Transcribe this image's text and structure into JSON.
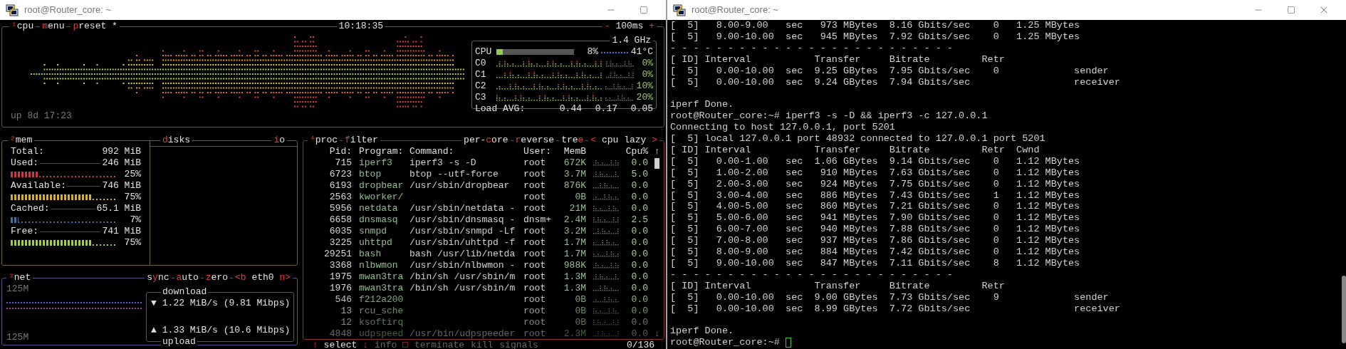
{
  "left_window": {
    "title": "root@Router_core: ~",
    "cpu_box": {
      "tabs": [
        [
          {
            "text": "¹",
            "hot": true
          },
          {
            "text": "cpu",
            "hot": false
          }
        ],
        [
          {
            "text": "m",
            "hot": true
          },
          {
            "text": "enu",
            "hot": false
          }
        ],
        [
          {
            "text": "p",
            "hot": true
          },
          {
            "text": "reset *",
            "hot": false
          }
        ]
      ],
      "clock": "10:18:35",
      "interval": {
        "minus": "-",
        "value": "100ms",
        "plus": "+"
      },
      "frequency": "1.4 GHz",
      "uptime": "up 8d 17:23",
      "cpu_total": {
        "label": "CPU",
        "level": 0.08,
        "percent": "8%",
        "temperature": "41°C"
      },
      "cores": [
        {
          "label": "C0",
          "percent": "0%"
        },
        {
          "label": "C1",
          "percent": "0%"
        },
        {
          "label": "C2",
          "percent": "10%"
        },
        {
          "label": "C3",
          "percent": "20%"
        }
      ],
      "load": {
        "label": "Load AVG:",
        "values": [
          "0.44",
          "0.17",
          "0.05"
        ]
      }
    },
    "mem_box": {
      "title": [
        {
          "text": "²",
          "hot": true
        },
        {
          "text": "mem",
          "hot": false
        }
      ],
      "rows": [
        {
          "kind": "total",
          "label": "Total:",
          "value": "992 MiB"
        },
        {
          "kind": "meter",
          "label": "Used:",
          "value": "246 MiB",
          "percent": "25%",
          "level": 0.25,
          "color": "#c83c3c"
        },
        {
          "kind": "meter",
          "label": "Available:",
          "value": "746 MiB",
          "percent": "75%",
          "level": 0.75,
          "color": "#d8b020"
        },
        {
          "kind": "meter",
          "label": "Cached:",
          "value": "65.1 MiB",
          "percent": "7%",
          "level": 0.07,
          "color": "#3c6ea8"
        },
        {
          "kind": "meter",
          "label": "Free:",
          "value": "741 MiB",
          "percent": "75%",
          "level": 0.75,
          "color": "#a0d040"
        }
      ]
    },
    "disks_box": {
      "title": [
        {
          "text": "d",
          "hot": true
        },
        {
          "text": "isks",
          "hot": false
        }
      ],
      "io": [
        {
          "text": "i",
          "hot": true
        },
        {
          "text": "o",
          "hot": false
        }
      ]
    },
    "net_box": {
      "title": [
        {
          "text": "³",
          "hot": true
        },
        {
          "text": "net",
          "hot": false
        }
      ],
      "controls": [
        [
          {
            "text": "s",
            "hot": false
          },
          {
            "text": "y",
            "hot": true
          },
          {
            "text": "nc",
            "hot": false
          }
        ],
        [
          {
            "text": "a",
            "hot": true
          },
          {
            "text": "uto",
            "hot": false
          }
        ],
        [
          {
            "text": "z",
            "hot": true
          },
          {
            "text": "ero",
            "hot": false
          }
        ],
        [
          {
            "text": "<b",
            "hot": true
          },
          {
            "text": " eth0 ",
            "hot": false
          },
          {
            "text": "n>",
            "hot": true
          }
        ]
      ],
      "scale_top": "125M",
      "scale_bottom": "125M",
      "download": {
        "label": "download",
        "arrow": "▼",
        "rate": "1.22 MiB/s (9.81 Mibps)"
      },
      "upload": {
        "label": "upload",
        "arrow": "▲",
        "rate": "1.33 MiB/s (10.6 Mibps)"
      }
    },
    "proc_box": {
      "title": [
        {
          "text": "⁴",
          "hot": true
        },
        {
          "text": "proc",
          "hot": false
        }
      ],
      "controls": [
        [
          {
            "text": "f",
            "hot": true
          },
          {
            "text": "ilter",
            "hot": false
          }
        ],
        [
          {
            "text": "per-",
            "hot": false
          },
          {
            "text": "c",
            "hot": true
          },
          {
            "text": "ore",
            "hot": false
          }
        ],
        [
          {
            "text": "r",
            "hot": true
          },
          {
            "text": "everse",
            "hot": false
          }
        ],
        [
          {
            "text": "tre",
            "hot": false
          },
          {
            "text": "e",
            "hot": true
          }
        ],
        [
          {
            "text": "<",
            "hot": true
          },
          {
            "text": " cpu lazy ",
            "hot": false
          },
          {
            "text": ">",
            "hot": true
          }
        ]
      ],
      "columns": [
        "Pid:",
        "Program:",
        "Command:",
        "User:",
        "MemB",
        "Cpu%"
      ],
      "rows": [
        {
          "pid": "715",
          "program": "iperf3",
          "command": "iperf3 -s -D",
          "user": "root",
          "mem": "672K",
          "cpu": "0.0"
        },
        {
          "pid": "6723",
          "program": "btop",
          "command": "btop --utf-force",
          "user": "root",
          "mem": "3.7M",
          "cpu": "5.0"
        },
        {
          "pid": "6193",
          "program": "dropbear",
          "command": "/usr/sbin/dropbear",
          "user": "root",
          "mem": "876K",
          "cpu": "0.0"
        },
        {
          "pid": "2563",
          "program": "kworker/",
          "command": "",
          "user": "root",
          "mem": "0B",
          "cpu": "0.0"
        },
        {
          "pid": "5956",
          "program": "netdata",
          "command": "/usr/sbin/netdata -",
          "user": "root",
          "mem": "21M",
          "cpu": "0.0"
        },
        {
          "pid": "6658",
          "program": "dnsmasq",
          "command": "/usr/sbin/dnsmasq -",
          "user": "dnsm+",
          "mem": "2.4M",
          "cpu": "2.5"
        },
        {
          "pid": "6035",
          "program": "snmpd",
          "command": "/usr/sbin/snmpd -Lf",
          "user": "root",
          "mem": "3.2M",
          "cpu": "0.0"
        },
        {
          "pid": "3225",
          "program": "uhttpd",
          "command": "/usr/sbin/uhttpd -f",
          "user": "root",
          "mem": "1.7M",
          "cpu": "0.0"
        },
        {
          "pid": "29251",
          "program": "bash",
          "command": "bash /usr/lib/netda",
          "user": "root",
          "mem": "1.7M",
          "cpu": "0.0"
        },
        {
          "pid": "3368",
          "program": "nlbwmon",
          "command": "/usr/sbin/nlbwmon -",
          "user": "root",
          "mem": "988K",
          "cpu": "0.0"
        },
        {
          "pid": "1975",
          "program": "mwan3tra",
          "command": "/bin/sh /usr/sbin/m",
          "user": "root",
          "mem": "1.3M",
          "cpu": "0.0"
        },
        {
          "pid": "1976",
          "program": "mwan3tra",
          "command": "/bin/sh /usr/sbin/m",
          "user": "root",
          "mem": "1.3M",
          "cpu": "0.0"
        },
        {
          "pid": "546",
          "program": "f212a200",
          "command": "",
          "user": "root",
          "mem": "0B",
          "cpu": "0.0"
        },
        {
          "pid": "13",
          "program": "rcu_sche",
          "command": "",
          "user": "root",
          "mem": "0B",
          "cpu": "0.0"
        },
        {
          "pid": "12",
          "program": "ksoftirq",
          "command": "",
          "user": "root",
          "mem": "0B",
          "cpu": "0.0"
        },
        {
          "pid": "4848",
          "program": "udpspeed",
          "command": "/usr/bin/udpspeeder",
          "user": "root",
          "mem": "2.3M",
          "cpu": "0.0"
        }
      ],
      "scroll_up": "↑",
      "scroll_down": "↓",
      "footer": [
        [
          {
            "text": "↑",
            "hot": true
          },
          {
            "text": " select ",
            "hot": false
          },
          {
            "text": "↓",
            "hot": true
          }
        ],
        [
          {
            "text": "info ",
            "hot": false
          },
          {
            "text": "□",
            "hot": true
          }
        ],
        [
          {
            "text": "terminate",
            "hot": false
          }
        ],
        [
          {
            "text": "kill",
            "hot": false
          }
        ],
        [
          {
            "text": "signals",
            "hot": false
          }
        ]
      ],
      "count": "0/136"
    }
  },
  "right_window": {
    "title": "root@Router_core: ~",
    "blocks": [
      [
        "[  5]   8.00-9.00   sec   973 MBytes  8.16 Gbits/sec    0   1.25 MBytes",
        "[  5]   9.00-10.00  sec   945 MBytes  7.92 Gbits/sec    0   1.25 MBytes",
        "- - - - - - - - - - - - - - - - - - - - - - - - -",
        "[ ID] Interval           Transfer     Bitrate         Retr",
        "[  5]   0.00-10.00  sec  9.25 GBytes  7.95 Gbits/sec    0             sender",
        "[  5]   0.00-10.00  sec  9.24 GBytes  7.94 Gbits/sec                  receiver"
      ],
      [
        "iperf Done.",
        "root@Router_core:~# iperf3 -s -D && iperf3 -c 127.0.0.1",
        "Connecting to host 127.0.0.1, port 5201",
        "[  5] local 127.0.0.1 port 48932 connected to 127.0.0.1 port 5201",
        "[ ID] Interval           Transfer     Bitrate         Retr  Cwnd",
        "[  5]   0.00-1.00   sec  1.06 GBytes  9.14 Gbits/sec    0   1.12 MBytes",
        "[  5]   1.00-2.00   sec   910 MBytes  7.63 Gbits/sec    0   1.12 MBytes",
        "[  5]   2.00-3.00   sec   924 MBytes  7.75 Gbits/sec    0   1.12 MBytes",
        "[  5]   3.00-4.00   sec   886 MBytes  7.43 Gbits/sec    1   1.12 MBytes",
        "[  5]   4.00-5.00   sec   860 MBytes  7.21 Gbits/sec    0   1.12 MBytes",
        "[  5]   5.00-6.00   sec   941 MBytes  7.90 Gbits/sec    0   1.12 MBytes",
        "[  5]   6.00-7.00   sec   940 MBytes  7.88 Gbits/sec    0   1.12 MBytes",
        "[  5]   7.00-8.00   sec   937 MBytes  7.86 Gbits/sec    0   1.12 MBytes",
        "[  5]   8.00-9.00   sec   884 MBytes  7.42 Gbits/sec    0   1.12 MBytes",
        "[  5]   9.00-10.00  sec   847 MBytes  7.11 Gbits/sec    8   1.12 MBytes",
        "- - - - - - - - - - - - - - - - - - - - - - - - -",
        "[ ID] Interval           Transfer     Bitrate         Retr",
        "[  5]   0.00-10.00  sec  9.00 GBytes  7.73 Gbits/sec    9             sender",
        "[  5]   0.00-10.00  sec  8.99 GBytes  7.72 Gbits/sec                  receiver"
      ],
      [
        "iperf Done."
      ]
    ],
    "prompt": "root@Router_core:~#",
    "cursor": true
  }
}
